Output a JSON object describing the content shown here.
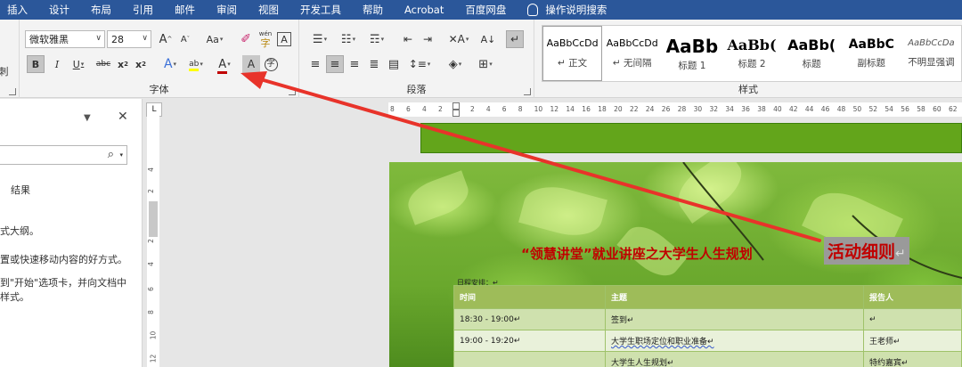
{
  "menubar": {
    "items": [
      "插入",
      "设计",
      "布局",
      "引用",
      "邮件",
      "审阅",
      "视图",
      "开发工具",
      "帮助",
      "Acrobat",
      "百度网盘"
    ],
    "tell_me": "操作说明搜索"
  },
  "ribbon": {
    "font_group": {
      "font_name": "微软雅黑",
      "font_size": "28",
      "label": "字体",
      "font_color": "#c00000",
      "highlight_color": "#ffff00"
    },
    "paragraph_group": {
      "label": "段落"
    },
    "styles_group": {
      "label": "样式",
      "items": [
        {
          "preview": "AaBbCcDd",
          "name": "↵ 正文"
        },
        {
          "preview": "AaBbCcDd",
          "name": "↵ 无间隔"
        },
        {
          "preview": "AaBb",
          "name": "标题 1"
        },
        {
          "preview": "AaBb(",
          "name": "标题 2"
        },
        {
          "preview": "AaBb(",
          "name": "标题"
        },
        {
          "preview": "AaBbC",
          "name": "副标题"
        },
        {
          "preview": "AaBbCcDa",
          "name": "不明显强调"
        }
      ]
    },
    "clipboard_label_fragment": "刺"
  },
  "navpane": {
    "tab_results": "结果",
    "line1": "式大纲。",
    "line2": "置或快速移动内容的好方式。",
    "line3": "到\"开始\"选项卡，并向文档中",
    "line4": "样式。"
  },
  "ruler": {
    "corner": "L",
    "left_ticks": [
      "8",
      "6",
      "4",
      "2"
    ],
    "ticks": [
      "2",
      "4",
      "6",
      "8",
      "10",
      "12",
      "14",
      "16",
      "18",
      "20",
      "22",
      "24",
      "26",
      "28",
      "30",
      "32",
      "34",
      "36",
      "38",
      "40",
      "42",
      "44",
      "46",
      "48",
      "50",
      "52",
      "54",
      "56",
      "58",
      "60",
      "62"
    ],
    "vertical_ticks": [
      "4",
      "2",
      "2",
      "4",
      "6",
      "8",
      "10",
      "12"
    ]
  },
  "document": {
    "title": "“领慧讲堂”就业讲座之大学生人生规划",
    "title_highlight": "活动细则",
    "return_mark": "↵",
    "schedule_caption": "日程安排：↵",
    "table": {
      "headers": [
        "时间",
        "主题",
        "报告人"
      ],
      "rows": [
        [
          "18:30 - 19:00↵",
          "签到↵",
          "↵"
        ],
        [
          "19:00 - 19:20↵",
          "大学生职场定位和职业准备↵",
          "王老师↵"
        ],
        [
          "",
          "大学生人生规划↵",
          "特约嘉宾↵"
        ]
      ]
    }
  }
}
